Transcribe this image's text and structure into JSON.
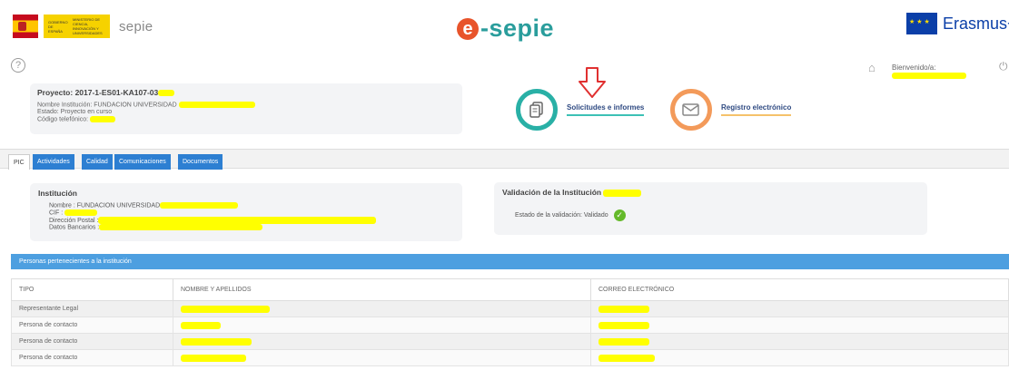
{
  "header": {
    "gov_text_1": "GOBIERNO DE ESPAÑA",
    "gov_text_2": "MINISTERIO DE CIENCIA, INNOVACIÓN Y UNIVERSIDADES",
    "sepie_small": "sepie",
    "brand_letter": "e",
    "brand_rest": "-sepie",
    "erasmus": "Erasmus+"
  },
  "utility": {
    "help": "?",
    "welcome_label": "Bienvenido/a:"
  },
  "project": {
    "title": "Proyecto: 2017-1-ES01-KA107-03",
    "institution_line": "Nombre Institución: FUNDACION UNIVERSIDAD",
    "status_line": "Estado: Proyecto en curso",
    "phone_line": "Código telefónico:"
  },
  "shortcuts": {
    "solicitudes": "Solicitudes e informes",
    "registro": "Registro electrónico"
  },
  "tabs": [
    {
      "label": "PIC"
    },
    {
      "label": "Actividades"
    },
    {
      "label": "Calidad"
    },
    {
      "label": "Comunicaciones"
    },
    {
      "label": "Documentos"
    }
  ],
  "institution": {
    "title": "Institución",
    "name_line": "Nombre : FUNDACION UNIVERSIDAD",
    "cif_line": "CIF :",
    "address_line": "Dirección Postal :",
    "bank_line": "Datos Bancarios :"
  },
  "validation": {
    "title": "Validación de la Institución",
    "status_line": "Estado de la validación: Validado"
  },
  "persons": {
    "header": "Personas pertenecientes a la institución",
    "columns": [
      "TIPO",
      "NOMBRE Y APELLIDOS",
      "CORREO ELECTRÓNICO"
    ],
    "rows": [
      {
        "tipo": "Representante Legal"
      },
      {
        "tipo": "Persona de contacto"
      },
      {
        "tipo": "Persona de contacto"
      },
      {
        "tipo": "Persona de contacto"
      }
    ]
  },
  "colors": {
    "brand_teal": "#2a9d9c",
    "brand_orange": "#e8542b",
    "tab_blue": "#2d7fd2",
    "table_header_blue": "#4d9fe0",
    "redaction_yellow": "#ffff00",
    "arrow_red": "#e03030",
    "validated_green": "#64b92a"
  },
  "icons": [
    "help-icon",
    "home-icon",
    "power-icon",
    "documents-icon",
    "mail-icon",
    "check-icon",
    "down-arrow-icon"
  ]
}
